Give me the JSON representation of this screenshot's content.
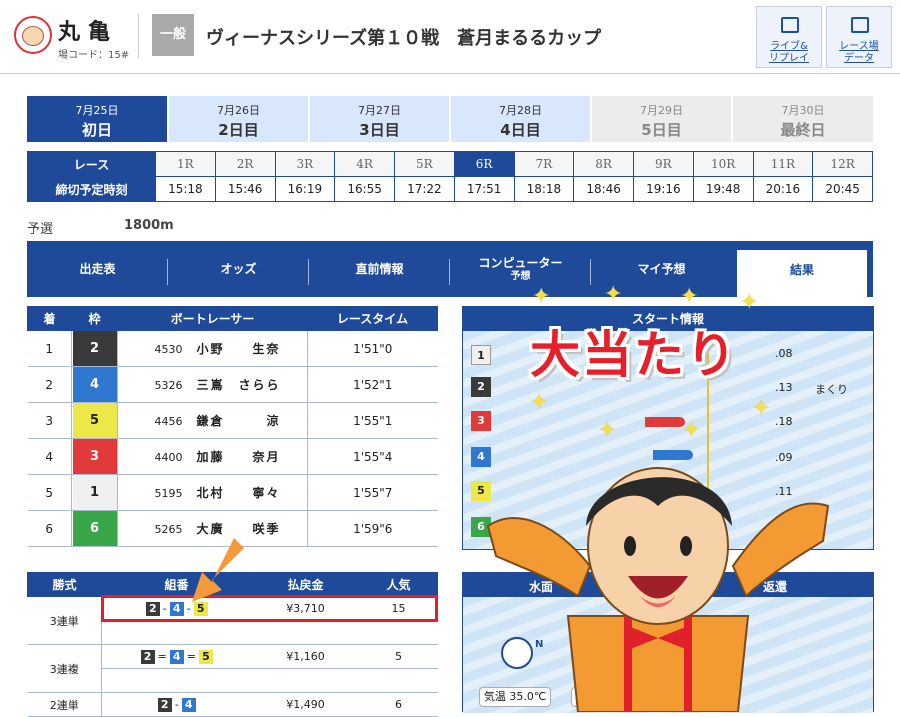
{
  "header": {
    "venue_name": "丸亀",
    "venue_code": "場コード：15#",
    "grade": "一般",
    "race_title": "ヴィーナスシリーズ第１０戦　蒼月まるるカップ",
    "btn_live": "ライブ&",
    "btn_live2": "リプレイ",
    "btn_data": "レース場",
    "btn_data2": "データ"
  },
  "days": [
    {
      "date": "7月25日",
      "label": "初日",
      "state": "active"
    },
    {
      "date": "7月26日",
      "label": "2日目",
      "state": "blue"
    },
    {
      "date": "7月27日",
      "label": "3日目",
      "state": "blue"
    },
    {
      "date": "7月28日",
      "label": "4日目",
      "state": "blue"
    },
    {
      "date": "7月29日",
      "label": "5日目",
      "state": "gray"
    },
    {
      "date": "7月30日",
      "label": "最終日",
      "state": "gray"
    }
  ],
  "race_table": {
    "race_header": "レース",
    "time_header": "締切予定時刻",
    "races": [
      "1R",
      "2R",
      "3R",
      "4R",
      "5R",
      "6R",
      "7R",
      "8R",
      "9R",
      "10R",
      "11R",
      "12R"
    ],
    "times": [
      "15:18",
      "15:46",
      "16:19",
      "16:55",
      "17:22",
      "17:51",
      "18:18",
      "18:46",
      "19:16",
      "19:48",
      "20:16",
      "20:45"
    ],
    "active_index": 5
  },
  "race_info": {
    "type": "予選",
    "distance": "1800m"
  },
  "tabs": [
    {
      "label": "出走表"
    },
    {
      "label": "オッズ"
    },
    {
      "label": "直前情報"
    },
    {
      "label": "コンピューター",
      "sub": "予想"
    },
    {
      "label": "マイ予想"
    },
    {
      "label": "結果",
      "active": true
    }
  ],
  "results": {
    "headers": [
      "着",
      "枠",
      "ボートレーサー",
      "レースタイム"
    ],
    "rows": [
      {
        "rank": "1",
        "waku": "2",
        "reg": "4530",
        "name": "小野　　生奈",
        "time": "1'51\"0"
      },
      {
        "rank": "2",
        "waku": "4",
        "reg": "5326",
        "name": "三嶌　さらら",
        "time": "1'52\"1"
      },
      {
        "rank": "3",
        "waku": "5",
        "reg": "4456",
        "name": "鎌倉　　　涼",
        "time": "1'55\"1"
      },
      {
        "rank": "4",
        "waku": "3",
        "reg": "4400",
        "name": "加藤　　奈月",
        "time": "1'55\"4"
      },
      {
        "rank": "5",
        "waku": "1",
        "reg": "5195",
        "name": "北村　　寧々",
        "time": "1'55\"7"
      },
      {
        "rank": "6",
        "waku": "6",
        "reg": "5265",
        "name": "大廣　　咲季",
        "time": "1'59\"6"
      }
    ]
  },
  "start_info": {
    "title": "スタート情報",
    "lanes": [
      "1",
      "2",
      "3",
      "4",
      "5",
      "6"
    ],
    "times": [
      ".08",
      ".13",
      ".18",
      ".09",
      ".11",
      ""
    ],
    "kimarite": "まくり"
  },
  "payouts": {
    "headers": [
      "勝式",
      "組番",
      "払戻金",
      "人気"
    ],
    "rows": [
      {
        "type": "3連単",
        "combo": [
          "2",
          "4",
          "5"
        ],
        "sep": "-",
        "amount": "¥3,710",
        "pop": "15"
      },
      {
        "type": "3連複",
        "combo": [
          "2",
          "4",
          "5"
        ],
        "sep": "=",
        "amount": "¥1,160",
        "pop": "5"
      },
      {
        "type": "2連単",
        "combo": [
          "2",
          "4"
        ],
        "sep": "-",
        "amount": "¥1,490",
        "pop": "6"
      }
    ]
  },
  "weather": {
    "title_left": "水面",
    "title_right": "返還",
    "temp": "気温 35.0℃",
    "compass_n": "N"
  },
  "overlay": {
    "banner": "大当たり"
  },
  "colors": {
    "primary": "#1f4a99",
    "highlight": "#e0202a"
  }
}
